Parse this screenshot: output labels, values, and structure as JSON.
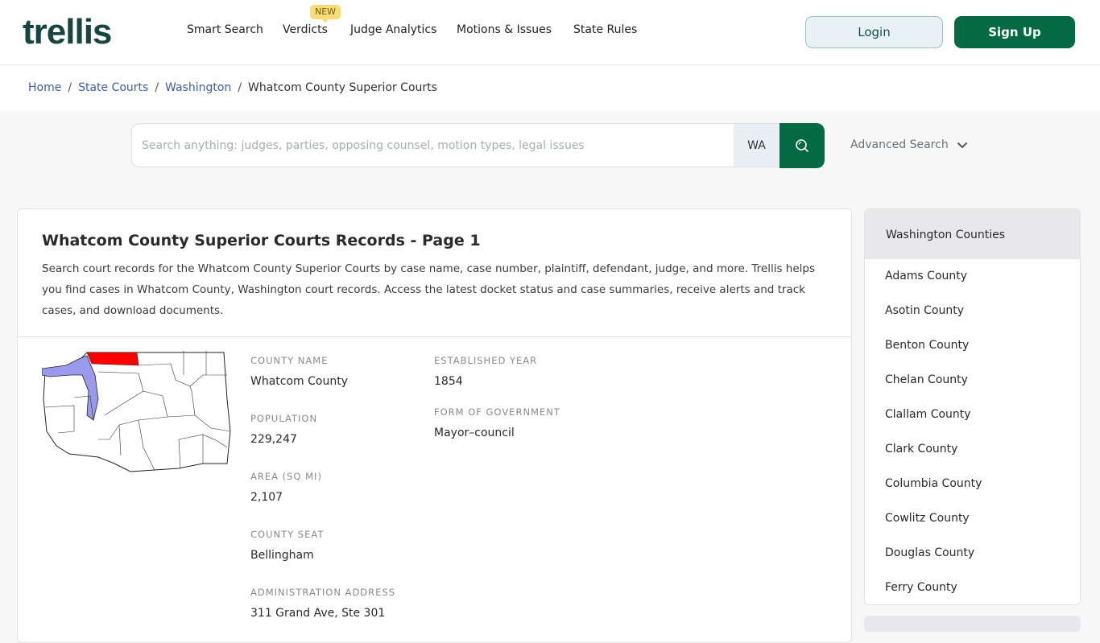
{
  "header": {
    "logo": "trellis",
    "nav": [
      {
        "label": "Smart Search"
      },
      {
        "label": "Verdicts",
        "badge": "NEW"
      },
      {
        "label": "Judge Analytics"
      },
      {
        "label": "Motions & Issues"
      },
      {
        "label": "State Rules"
      }
    ],
    "login_label": "Login",
    "signup_label": "Sign Up"
  },
  "breadcrumb": [
    {
      "label": "Home"
    },
    {
      "label": "State Courts"
    },
    {
      "label": "Washington"
    },
    {
      "label": "Whatcom County Superior Courts"
    }
  ],
  "search": {
    "placeholder": "Search anything: judges, parties, opposing counsel, motion types, legal issues",
    "value": "",
    "state": "WA",
    "advanced_label": "Advanced Search"
  },
  "main": {
    "title": "Whatcom County Superior Courts Records - Page 1",
    "description": "Search court records for the Whatcom County Superior Courts by case name, case number, plaintiff, defendant, judge, and more. Trellis helps you find cases in Whatcom County, Washington court records. Access the latest docket status and case summaries, receive alerts and track cases, and download documents.",
    "facts": {
      "county_name": {
        "label": "County Name",
        "value": "Whatcom County"
      },
      "population": {
        "label": "Population",
        "value": "229,247"
      },
      "area": {
        "label": "Area (sq mi)",
        "value": "2,107"
      },
      "county_seat": {
        "label": "County Seat",
        "value": "Bellingham"
      },
      "admin_address": {
        "label": "Administration Address",
        "value": "311 Grand Ave, Ste 301"
      },
      "established": {
        "label": "Established Year",
        "value": "1854"
      },
      "government": {
        "label": "Form of Government",
        "value": "Mayor–council"
      }
    },
    "map": {
      "highlight_color": "#ff0000",
      "water_color": "#9999ee"
    }
  },
  "sidebar": {
    "title": "Washington Counties",
    "items": [
      {
        "label": "Adams County"
      },
      {
        "label": "Asotin County"
      },
      {
        "label": "Benton County"
      },
      {
        "label": "Chelan County"
      },
      {
        "label": "Clallam County"
      },
      {
        "label": "Clark County"
      },
      {
        "label": "Columbia County"
      },
      {
        "label": "Cowlitz County"
      },
      {
        "label": "Douglas County"
      },
      {
        "label": "Ferry County"
      }
    ]
  },
  "colors": {
    "brand": "#046a45",
    "logo": "#17453f",
    "link": "#3d5cb0",
    "badge": "#fbdc74"
  }
}
